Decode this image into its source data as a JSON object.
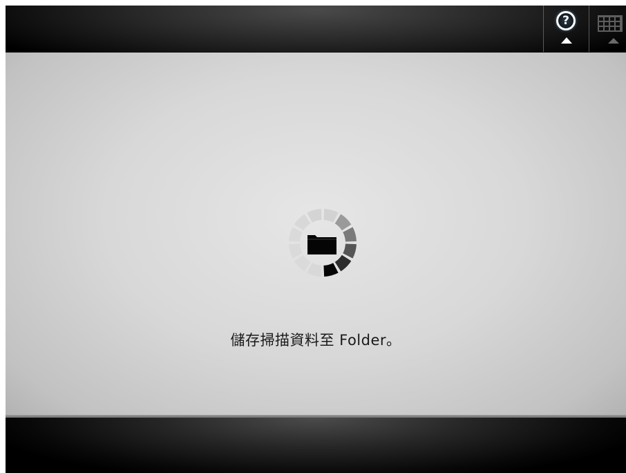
{
  "header": {
    "help_icon": "help-icon",
    "help_glyph": "?",
    "keyboard_icon": "keyboard-icon"
  },
  "main": {
    "status_message": "儲存掃描資料至 Folder。",
    "progress_icon": "folder-icon",
    "spinner_icon": "loading-spinner-icon"
  },
  "colors": {
    "top_bar": "#1a1a1a",
    "panel": "#d8d8d8",
    "spinner_active": "#111111",
    "spinner_inactive": "#d6d6d6"
  }
}
